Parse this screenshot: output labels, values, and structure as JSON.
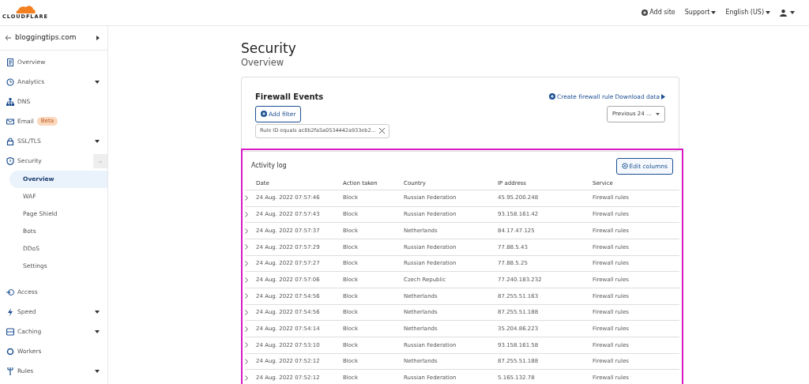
{
  "header": {
    "logo": "CLOUDFLARE",
    "links": [
      {
        "label": "Add site",
        "kind": "add"
      },
      {
        "label": "Support",
        "kind": "menu"
      },
      {
        "label": "English (US)",
        "kind": "menu"
      },
      {
        "kind": "user"
      }
    ]
  },
  "sidebar": {
    "site": "bloggingtips.com",
    "items": [
      {
        "label": "Overview",
        "has_menu": false
      },
      {
        "label": "Analytics",
        "has_menu": true
      },
      {
        "label": "DNS",
        "has_menu": false
      },
      {
        "label": "Email",
        "has_menu": false,
        "badge": "Beta"
      },
      {
        "label": "SSL/TLS",
        "has_menu": true
      },
      {
        "label": "Security",
        "has_menu": true,
        "expanded": true,
        "children": [
          {
            "label": "Overview",
            "selected": true
          },
          {
            "label": "WAF",
            "selected": false
          },
          {
            "label": "Page Shield",
            "selected": false
          },
          {
            "label": "Bots",
            "selected": false
          },
          {
            "label": "DDoS",
            "selected": false
          },
          {
            "label": "Settings",
            "selected": false
          }
        ]
      },
      {
        "label": "Access",
        "has_menu": false
      },
      {
        "label": "Speed",
        "has_menu": true
      },
      {
        "label": "Caching",
        "has_menu": true
      },
      {
        "label": "Workers",
        "has_menu": false
      },
      {
        "label": "Rules",
        "has_menu": true
      }
    ]
  },
  "page": {
    "title": "Security",
    "subtitle": "Overview"
  },
  "firewall": {
    "title": "Firewall Events",
    "create_rule": "Create firewall rule",
    "download": "Download data",
    "add_filter": "Add filter",
    "filter_chip": "Rule ID equals ac8b2fa5a0534442a933eb2...",
    "time_range": "Previous 24 ..."
  },
  "activity_log": {
    "title": "Activity log",
    "edit_columns": "Edit columns",
    "columns": [
      "Date",
      "Action taken",
      "Country",
      "IP address",
      "Service"
    ],
    "rows": [
      [
        "24 Aug. 2022 07:57:46",
        "Block",
        "Russian Federation",
        "45.95.200.248",
        "Firewall rules"
      ],
      [
        "24 Aug. 2022 07:57:43",
        "Block",
        "Russian Federation",
        "93.158.161.42",
        "Firewall rules"
      ],
      [
        "24 Aug. 2022 07:57:37",
        "Block",
        "Netherlands",
        "84.17.47.125",
        "Firewall rules"
      ],
      [
        "24 Aug. 2022 07:57:29",
        "Block",
        "Russian Federation",
        "77.88.5.43",
        "Firewall rules"
      ],
      [
        "24 Aug. 2022 07:57:27",
        "Block",
        "Russian Federation",
        "77.88.5.25",
        "Firewall rules"
      ],
      [
        "24 Aug. 2022 07:57:06",
        "Block",
        "Czech Republic",
        "77.240.183.232",
        "Firewall rules"
      ],
      [
        "24 Aug. 2022 07:54:56",
        "Block",
        "Netherlands",
        "87.255.51.163",
        "Firewall rules"
      ],
      [
        "24 Aug. 2022 07:54:56",
        "Block",
        "Netherlands",
        "87.255.51.188",
        "Firewall rules"
      ],
      [
        "24 Aug. 2022 07:54:14",
        "Block",
        "Netherlands",
        "35.204.86.223",
        "Firewall rules"
      ],
      [
        "24 Aug. 2022 07:53:10",
        "Block",
        "Russian Federation",
        "93.158.161.58",
        "Firewall rules"
      ],
      [
        "24 Aug. 2022 07:52:12",
        "Block",
        "Netherlands",
        "87.255.51.188",
        "Firewall rules"
      ],
      [
        "24 Aug. 2022 07:52:12",
        "Block",
        "Russian Federation",
        "5.165.132.78",
        "Firewall rules"
      ]
    ]
  }
}
